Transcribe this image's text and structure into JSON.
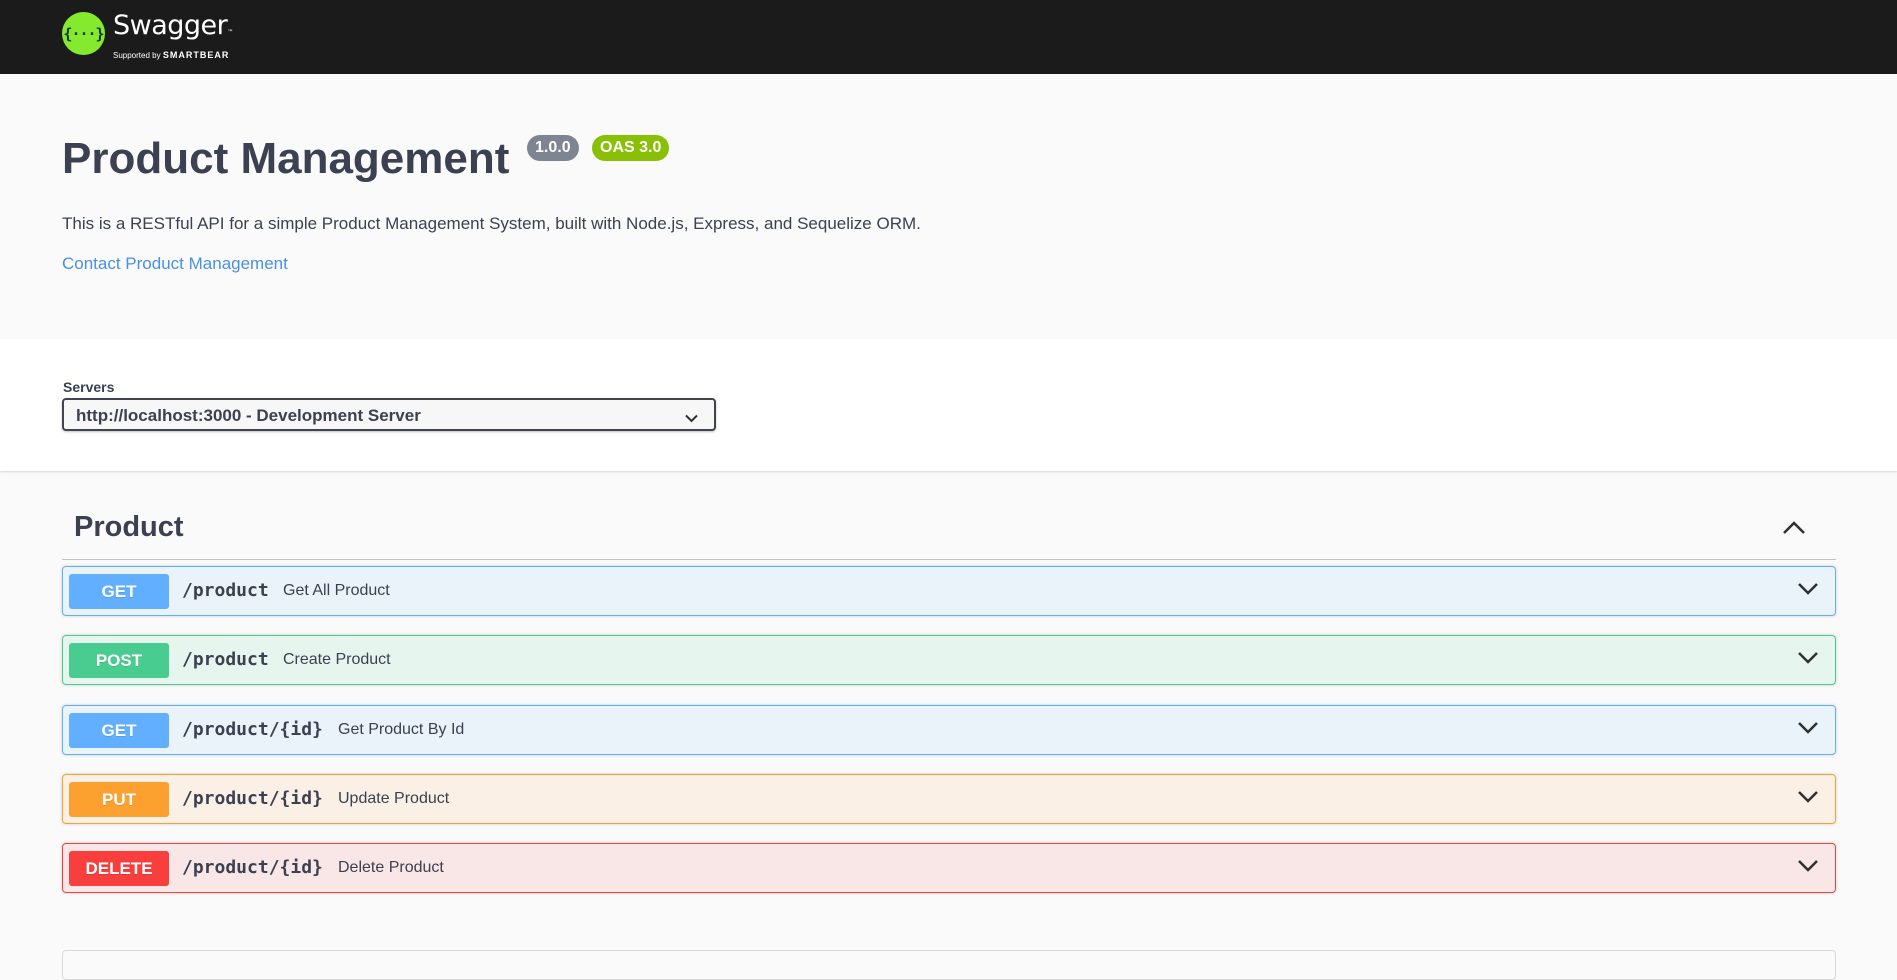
{
  "topbar": {
    "logo_glyph": "{···}",
    "brand": "Swagger",
    "brand_mark": "™",
    "supported_by": "Supported by",
    "sponsor": "SMARTBEAR"
  },
  "info": {
    "title": "Product Management",
    "version": "1.0.0",
    "oas": "OAS 3.0",
    "description": "This is a RESTful API for a simple Product Management System, built with Node.js, Express, and Sequelize ORM.",
    "contact": "Contact Product Management"
  },
  "servers": {
    "label": "Servers",
    "selected": "http://localhost:3000 - Development Server"
  },
  "tag": {
    "name": "Product",
    "expanded": true
  },
  "operations": [
    {
      "method": "GET",
      "path": "/product",
      "summary": "Get All Product",
      "color": "#61affe"
    },
    {
      "method": "POST",
      "path": "/product",
      "summary": "Create Product",
      "color": "#49cc90"
    },
    {
      "method": "GET",
      "path": "/product/{id}",
      "summary": "Get Product By Id",
      "color": "#61affe"
    },
    {
      "method": "PUT",
      "path": "/product/{id}",
      "summary": "Update Product",
      "color": "#fca130"
    },
    {
      "method": "DELETE",
      "path": "/product/{id}",
      "summary": "Delete Product",
      "color": "#f93e3e"
    }
  ]
}
